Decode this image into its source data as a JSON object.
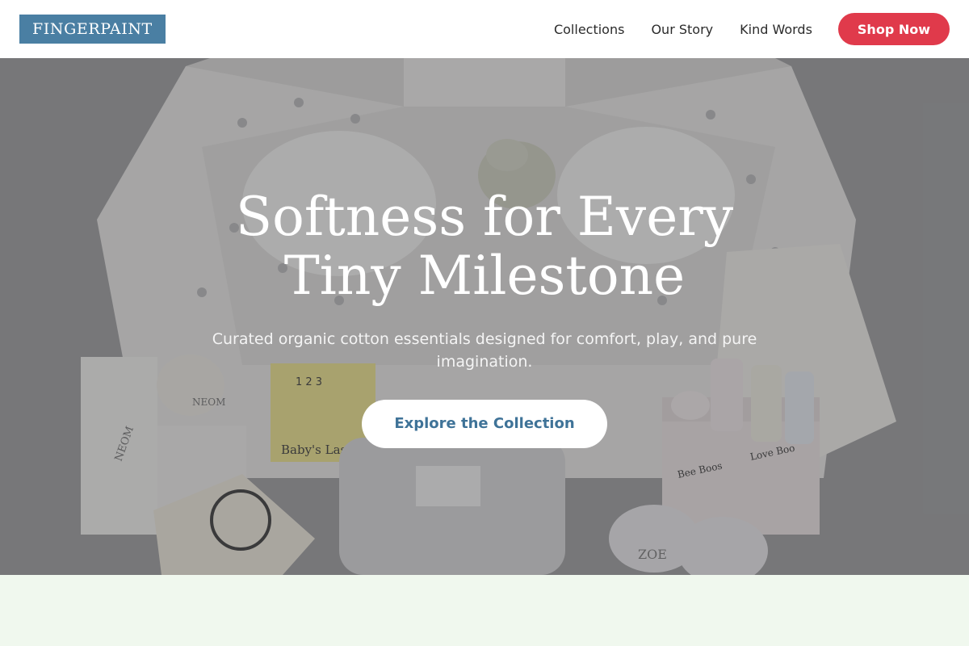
{
  "brand": {
    "name": "FINGERPAINT",
    "color": "#4a7fa3"
  },
  "nav": {
    "links": [
      "Collections",
      "Our Story",
      "Kind Words"
    ],
    "cta_label": "Shop Now",
    "cta_color": "#e03a4b"
  },
  "hero": {
    "title": "Softness for Every Tiny Milestone",
    "subtitle": "Curated organic cotton essentials designed for comfort, play, and pure imagination.",
    "cta_label": "Explore the Collection",
    "cta_text_color": "#3f7398",
    "image_text": {
      "card_digits": "1 2 3",
      "card_caption": "Baby's Last",
      "candle_brand": "NEOM",
      "giftbox_brand": "Love Boo",
      "giftbox_label": "Bee Boos",
      "muslin_label": "ZOE"
    }
  },
  "next_section": {
    "background": "#f0f8ee"
  }
}
